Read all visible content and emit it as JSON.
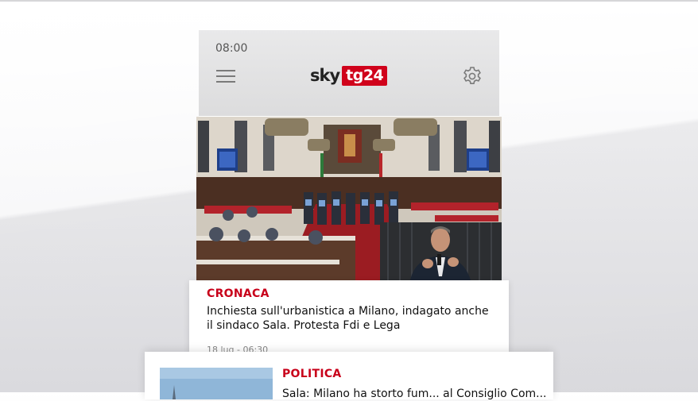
{
  "status_bar": {
    "time": "08:00"
  },
  "header": {
    "logo_sky": "sky",
    "logo_tg24": "tg24",
    "brand_color": "#d0021b"
  },
  "icons": {
    "menu": "hamburger-icon",
    "settings": "gear-icon"
  },
  "articles": [
    {
      "category": "CRONACA",
      "headline": "Inchiesta sull'urbanistica a Milano, indagato anche il sindaco Sala. Protesta Fdi e Lega",
      "date": "18 lug - 06:30"
    },
    {
      "category": "POLITICA",
      "headline": "Sala: Milano ha storto fum... al Consiglio Com..."
    }
  ],
  "category_color": "#c8001a"
}
